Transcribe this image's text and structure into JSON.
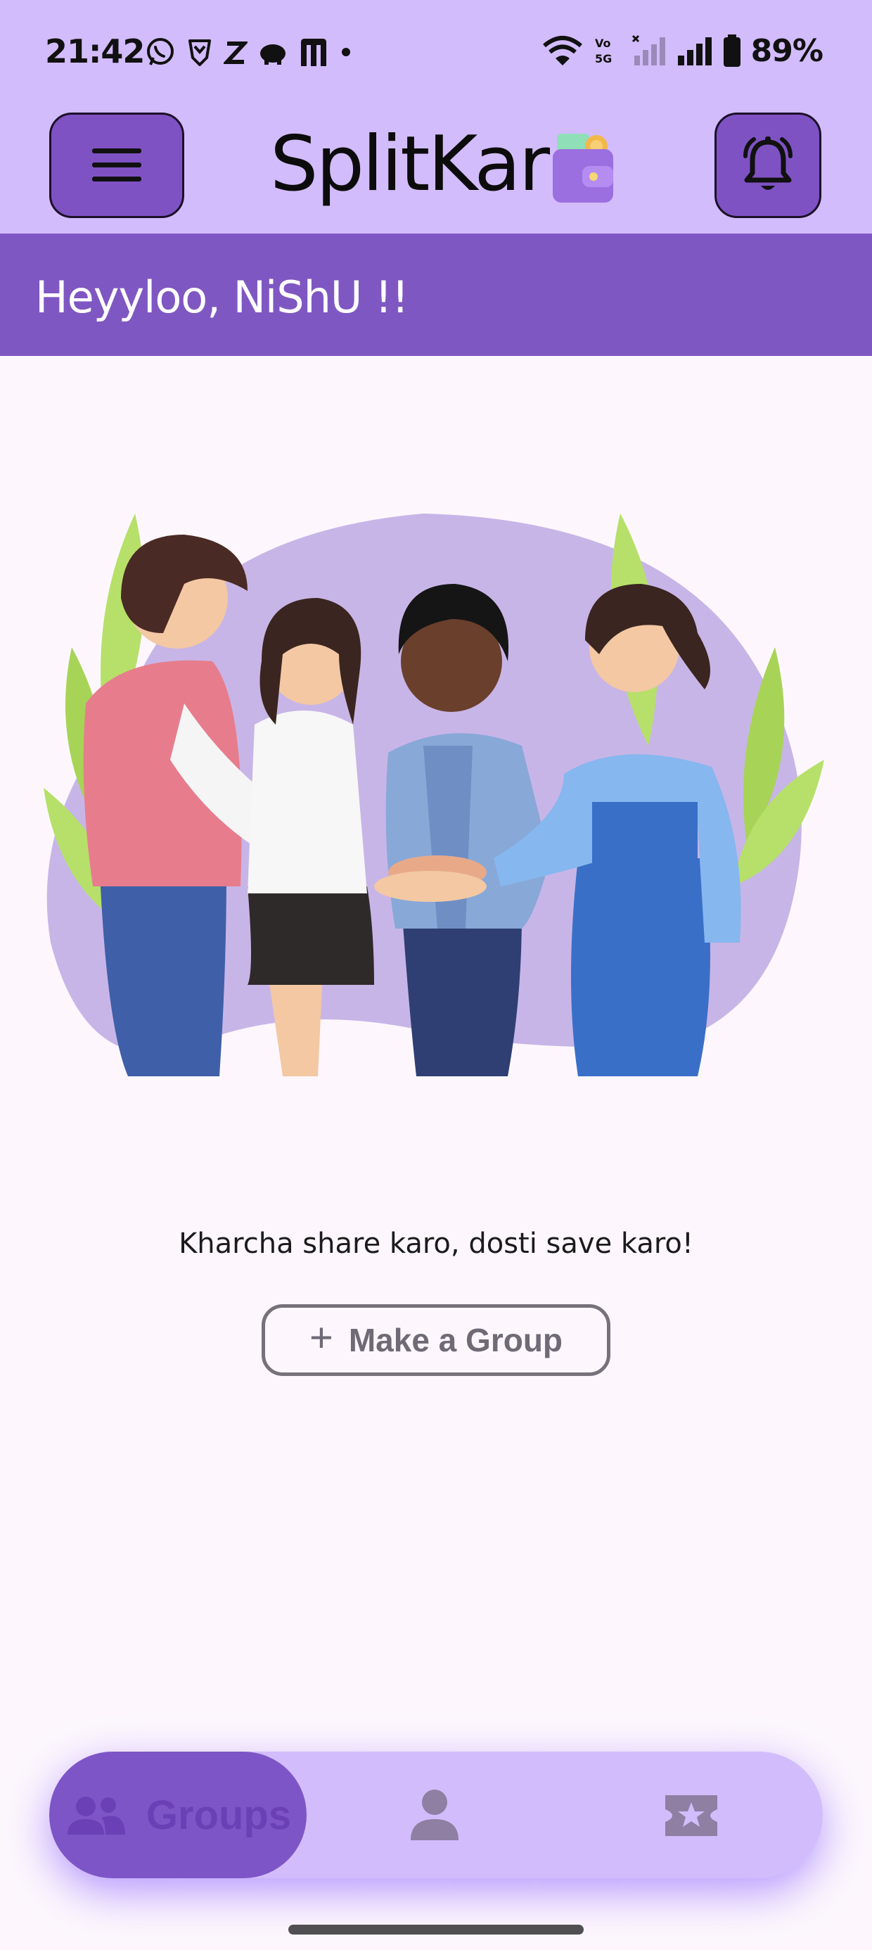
{
  "status_bar": {
    "time": "21:42",
    "battery_percent": "89%",
    "left_icons": [
      "whatsapp-icon",
      "brave-icon",
      "z-icon",
      "piggy-icon",
      "m-icon",
      "dot-icon"
    ],
    "right_icons": [
      "wifi-icon",
      "volte-icon",
      "signal-sim1-icon",
      "signal-sim2-icon",
      "battery-icon"
    ]
  },
  "app_bar": {
    "title": "SplitKar",
    "menu_icon": "menu-icon",
    "notification_icon": "bell-icon",
    "logo_icon": "wallet-icon"
  },
  "greeting": "Heyyloo, NiShU !!",
  "main": {
    "tagline": "Kharcha share karo, dosti save karo!",
    "make_group_label": "Make a Group",
    "make_group_icon": "plus-icon"
  },
  "bottom_nav": {
    "items": [
      {
        "label": "Groups",
        "icon": "group-icon",
        "selected": true
      },
      {
        "label": "",
        "icon": "person-icon",
        "selected": false
      },
      {
        "label": "",
        "icon": "ticket-star-icon",
        "selected": false
      }
    ]
  },
  "colors": {
    "top_background": "#d3bcfb",
    "accent_purple": "#7f57c2",
    "page_background": "#fdf7fd",
    "button_outline": "#76717b"
  }
}
